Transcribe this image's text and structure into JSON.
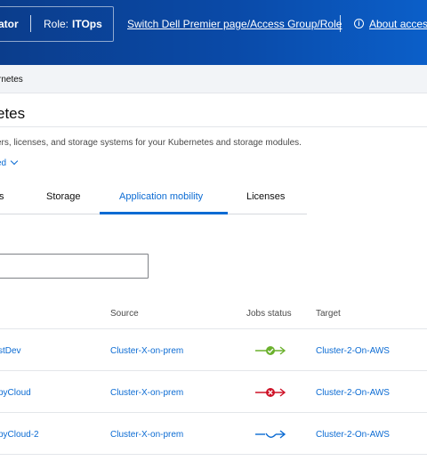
{
  "header": {
    "role_partial": "ator",
    "role_label": "Role:",
    "role_value": "ITOps",
    "switch_link": "Switch Dell Premier page/Access Group/Role",
    "about_link": "About access",
    "info_icon": "info-icon"
  },
  "breadcrumb": "rnetes",
  "page": {
    "title": "etes",
    "description": "ers, licenses, and storage systems for your Kubernetes and storage modules.",
    "expand_label": "ed"
  },
  "tabs": [
    {
      "label": "s",
      "active": false
    },
    {
      "label": "Storage",
      "active": false
    },
    {
      "label": "Application mobility",
      "active": true
    },
    {
      "label": "Licenses",
      "active": false
    }
  ],
  "search": {
    "value": "",
    "placeholder": ""
  },
  "table": {
    "columns": [
      "Source",
      "Jobs status",
      "Target"
    ],
    "rows": [
      {
        "name": "stDev",
        "source": "Cluster-X-on-prem",
        "status": "success",
        "target": "Cluster-2-On-AWS"
      },
      {
        "name": "pyCloud",
        "source": "Cluster-X-on-prem",
        "status": "failed",
        "target": "Cluster-2-On-AWS"
      },
      {
        "name": "pyCloud-2",
        "source": "Cluster-X-on-prem",
        "status": "in-progress",
        "target": "Cluster-2-On-AWS"
      }
    ]
  },
  "colors": {
    "accent": "#0b6bd3",
    "success": "#6bb12d",
    "failed": "#ce1126",
    "in_progress": "#0b6bd3"
  }
}
